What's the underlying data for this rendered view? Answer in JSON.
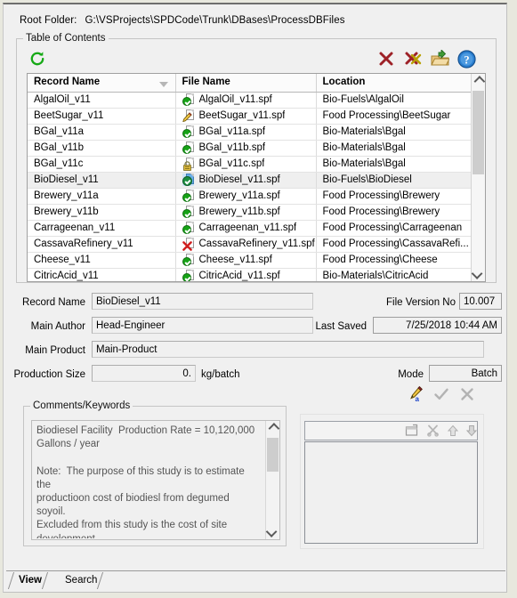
{
  "window": {
    "root_folder_label": "Root Folder:",
    "root_folder_path": "G:\\VSProjects\\SPDCode\\Trunk\\DBases\\ProcessDBFiles"
  },
  "toc": {
    "group_title": "Table of Contents",
    "toolbar": {
      "refresh": "refresh-icon",
      "delete": "delete-x-icon",
      "delete_all": "delete-all-icon",
      "open_folder": "open-folder-icon",
      "help": "help-icon"
    },
    "columns": [
      "Record Name",
      "File Name",
      "Location"
    ],
    "sort_column": "Record Name",
    "rows": [
      {
        "record": "AlgalOil_v11",
        "file": "AlgalOil_v11.spf",
        "location": "Bio-Fuels\\AlgalOil",
        "status": "check",
        "selected": false
      },
      {
        "record": "BeetSugar_v11",
        "file": "BeetSugar_v11.spf",
        "location": "Food Processing\\BeetSugar",
        "status": "pencil",
        "selected": false
      },
      {
        "record": "BGal_v11a",
        "file": "BGal_v11a.spf",
        "location": "Bio-Materials\\Bgal",
        "status": "check",
        "selected": false
      },
      {
        "record": "BGal_v11b",
        "file": "BGal_v11b.spf",
        "location": "Bio-Materials\\Bgal",
        "status": "check",
        "selected": false
      },
      {
        "record": "BGal_v11c",
        "file": "BGal_v11c.spf",
        "location": "Bio-Materials\\Bgal",
        "status": "lock",
        "selected": false
      },
      {
        "record": "BioDiesel_v11",
        "file": "BioDiesel_v11.spf",
        "location": "Bio-Fuels\\BioDiesel",
        "status": "open",
        "selected": true
      },
      {
        "record": "Brewery_v11a",
        "file": "Brewery_v11a.spf",
        "location": "Food Processing\\Brewery",
        "status": "check",
        "selected": false
      },
      {
        "record": "Brewery_v11b",
        "file": "Brewery_v11b.spf",
        "location": "Food Processing\\Brewery",
        "status": "check",
        "selected": false
      },
      {
        "record": "Carrageenan_v11",
        "file": "Carrageenan_v11.spf",
        "location": "Food Processing\\Carrageenan",
        "status": "check",
        "selected": false
      },
      {
        "record": "CassavaRefinery_v11",
        "file": "CassavaRefinery_v11.spf",
        "location": "Food Processing\\CassavaRefi...",
        "status": "x",
        "selected": false
      },
      {
        "record": "Cheese_v11",
        "file": "Cheese_v11.spf",
        "location": "Food Processing\\Cheese",
        "status": "check",
        "selected": false
      },
      {
        "record": "CitricAcid_v11",
        "file": "CitricAcid_v11.spf",
        "location": "Bio-Materials\\CitricAcid",
        "status": "check",
        "selected": false
      }
    ]
  },
  "details": {
    "record_name_label": "Record Name",
    "record_name_value": "BioDiesel_v11",
    "file_version_label": "File Version No",
    "file_version_value": "10.007",
    "main_author_label": "Main Author",
    "main_author_value": "Head-Engineer",
    "last_saved_label": "Last Saved",
    "last_saved_value": "7/25/2018 10:44 AM",
    "main_product_label": "Main Product",
    "main_product_value": "Main-Product",
    "production_size_label": "Production Size",
    "production_size_value": "0.",
    "production_size_unit": "kg/batch",
    "mode_label": "Mode",
    "mode_value": "Batch"
  },
  "actions": {
    "edit": "edit-pencil-icon",
    "accept": "accept-check-icon",
    "cancel": "cancel-x-icon"
  },
  "comments": {
    "group_title": "Comments/Keywords",
    "text": "Biodiesel Facility  Production Rate = 10,120,000\nGallons / year\n\nNote:  The purpose of this study is to estimate the\nproductioon cost of biodiesl from degumed soyoil.\nExcluded from this study is the cost of site development\nwork, environmental control systems  and all faclities\noutside of the biodiesel processiong  area. Also\nexcluded from this study is the cost of capital, the\nimpact of governmental incentives and  taxes, working"
  },
  "keywords": {
    "toolbar": {
      "new": "new-item-icon",
      "delete": "delete-scissors-icon",
      "move_up": "move-up-icon",
      "move_down": "move-down-icon"
    },
    "items": []
  },
  "tabs": [
    {
      "label": "View",
      "active": true
    },
    {
      "label": "Search",
      "active": false
    }
  ]
}
